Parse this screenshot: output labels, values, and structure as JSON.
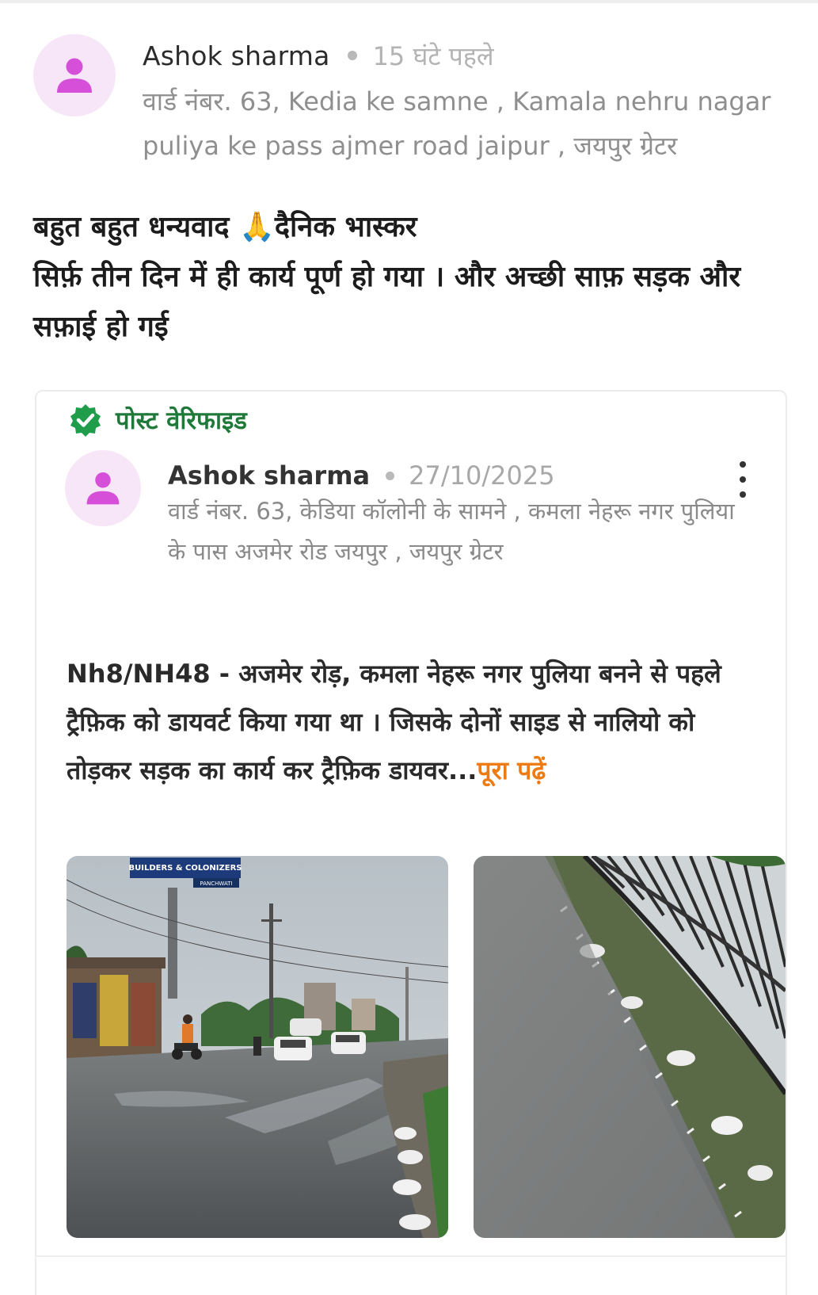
{
  "post": {
    "author": "Ashok sharma",
    "time_ago": "15 घंटे पहले",
    "address": "वार्ड नंबर. 63, Kedia ke samne , Kamala nehru nagar puliya ke pass ajmer road jaipur , जयपुर ग्रेटर",
    "body_lines": [
      "बहुत बहुत धन्यवाद 🙏दैनिक भास्कर",
      "सिर्फ़ तीन दिन में ही कार्य पूर्ण हो गया । और अच्छी साफ़ सड़क और सफ़ाई हो गई"
    ]
  },
  "shared_post": {
    "verified_label": "पोस्ट वेरिफाइड",
    "author": "Ashok sharma",
    "date": "27/10/2025",
    "address": "वार्ड नंबर. 63, केडिया कॉलोनी के सामने , कमला नेहरू नगर पुलिया के पास अजमेर रोड जयपुर , जयपुर ग्रेटर",
    "body": "Nh8/NH48 - अजमेर रोड़, कमला नेहरू नगर पुलिया बनने से पहले ट्रैफ़िक को डायवर्ट किया गया था । जिसके दोनों साइड से नालियो को तोड़कर सड़क का कार्य कर ट्रैफ़िक डायवर...",
    "read_more": "पूरा पढ़ें",
    "photos": [
      {
        "sign_line1": "BUILDERS & COLONIZERS",
        "sign_line2": "PANCHWATI"
      },
      {}
    ]
  },
  "colors": {
    "avatar_bg": "#f7e6f7",
    "avatar_icon": "#d64fd9",
    "verified_green": "#1f9d4a",
    "read_more": "#f07a12"
  },
  "icons": [
    "person-icon",
    "verified-badge-icon",
    "more-vertical-icon"
  ]
}
